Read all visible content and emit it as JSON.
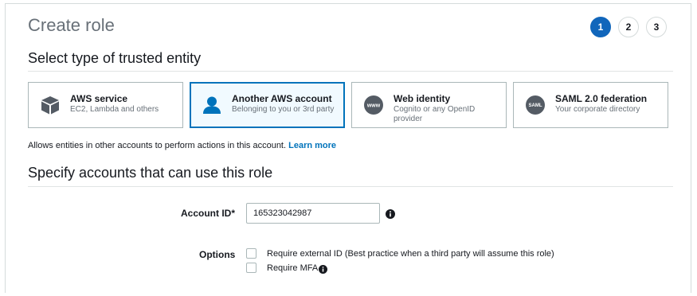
{
  "header": {
    "title": "Create role",
    "steps": [
      "1",
      "2",
      "3"
    ],
    "active_step": 1
  },
  "trusted_entity": {
    "heading": "Select type of trusted entity",
    "cards": [
      {
        "title": "AWS service",
        "subtitle": "EC2, Lambda and others",
        "icon": "cube-icon",
        "selected": false
      },
      {
        "title": "Another AWS account",
        "subtitle": "Belonging to you or 3rd party",
        "icon": "user-icon",
        "selected": true
      },
      {
        "title": "Web identity",
        "subtitle": "Cognito or any OpenID provider",
        "icon": "www-icon",
        "icon_text": "www",
        "selected": false
      },
      {
        "title": "SAML 2.0 federation",
        "subtitle": "Your corporate directory",
        "icon": "saml-icon",
        "icon_text": "SAML",
        "selected": false
      }
    ],
    "help_text": "Allows entities in other accounts to perform actions in this account.",
    "learn_more": "Learn more"
  },
  "accounts": {
    "heading": "Specify accounts that can use this role",
    "account_id_label": "Account ID*",
    "account_id_value": "165323042987",
    "options_label": "Options",
    "options": [
      {
        "label": "Require external ID (Best practice when a third party will assume this role)",
        "checked": false
      },
      {
        "label": "Require MFA",
        "checked": false
      }
    ]
  },
  "colors": {
    "accent": "#0073bb",
    "step_active": "#1166bb",
    "icon_dark": "#545b64",
    "border": "#aab7b8"
  }
}
